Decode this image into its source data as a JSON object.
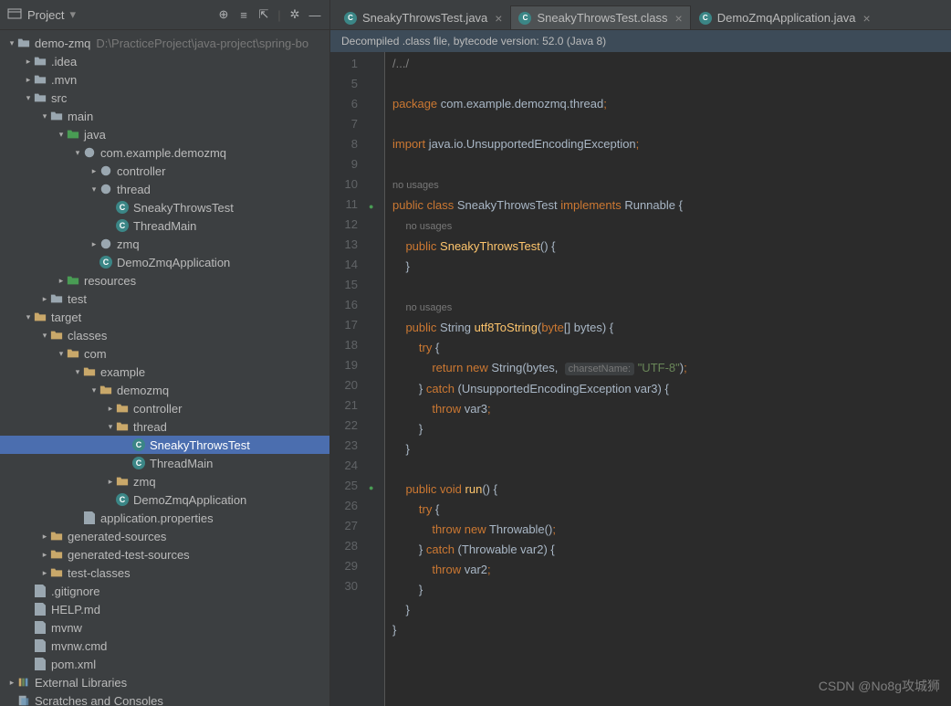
{
  "header": {
    "project": "Project",
    "iconbar": [
      "target",
      "collapse",
      "settings",
      "gear",
      "more"
    ]
  },
  "rootPath": "D:\\PracticeProject\\java-project\\spring-bo",
  "tree": [
    {
      "d": 0,
      "a": "v",
      "ico": "module",
      "lbl": "demo-zmq",
      "path": "D:\\PracticeProject\\java-project\\spring-bo"
    },
    {
      "d": 1,
      "a": ">",
      "ico": "fg",
      "lbl": ".idea"
    },
    {
      "d": 1,
      "a": ">",
      "ico": "fg",
      "lbl": ".mvn"
    },
    {
      "d": 1,
      "a": "v",
      "ico": "fg",
      "lbl": "src"
    },
    {
      "d": 2,
      "a": "v",
      "ico": "fg",
      "lbl": "main"
    },
    {
      "d": 3,
      "a": "v",
      "ico": "fb",
      "lbl": "java"
    },
    {
      "d": 4,
      "a": "v",
      "ico": "pkg",
      "lbl": "com.example.demozmq"
    },
    {
      "d": 5,
      "a": ">",
      "ico": "pkg",
      "lbl": "controller"
    },
    {
      "d": 5,
      "a": "v",
      "ico": "pkg",
      "lbl": "thread"
    },
    {
      "d": 6,
      "a": "",
      "ico": "cls",
      "lbl": "SneakyThrowsTest"
    },
    {
      "d": 6,
      "a": "",
      "ico": "cls",
      "lbl": "ThreadMain"
    },
    {
      "d": 5,
      "a": ">",
      "ico": "pkg",
      "lbl": "zmq"
    },
    {
      "d": 5,
      "a": "",
      "ico": "cls",
      "lbl": "DemoZmqApplication"
    },
    {
      "d": 3,
      "a": ">",
      "ico": "fb",
      "lbl": "resources"
    },
    {
      "d": 2,
      "a": ">",
      "ico": "fg",
      "lbl": "test"
    },
    {
      "d": 1,
      "a": "v",
      "ico": "fo",
      "lbl": "target"
    },
    {
      "d": 2,
      "a": "v",
      "ico": "fo",
      "lbl": "classes"
    },
    {
      "d": 3,
      "a": "v",
      "ico": "fo",
      "lbl": "com"
    },
    {
      "d": 4,
      "a": "v",
      "ico": "fo",
      "lbl": "example"
    },
    {
      "d": 5,
      "a": "v",
      "ico": "fo",
      "lbl": "demozmq"
    },
    {
      "d": 6,
      "a": ">",
      "ico": "fo",
      "lbl": "controller"
    },
    {
      "d": 6,
      "a": "v",
      "ico": "fo",
      "lbl": "thread"
    },
    {
      "d": 7,
      "a": "",
      "ico": "cls",
      "lbl": "SneakyThrowsTest",
      "sel": true
    },
    {
      "d": 7,
      "a": "",
      "ico": "cls",
      "lbl": "ThreadMain"
    },
    {
      "d": 6,
      "a": ">",
      "ico": "fo",
      "lbl": "zmq"
    },
    {
      "d": 6,
      "a": "",
      "ico": "cls",
      "lbl": "DemoZmqApplication"
    },
    {
      "d": 4,
      "a": "",
      "ico": "file",
      "lbl": "application.properties"
    },
    {
      "d": 2,
      "a": ">",
      "ico": "fo",
      "lbl": "generated-sources"
    },
    {
      "d": 2,
      "a": ">",
      "ico": "fo",
      "lbl": "generated-test-sources"
    },
    {
      "d": 2,
      "a": ">",
      "ico": "fo",
      "lbl": "test-classes"
    },
    {
      "d": 1,
      "a": "",
      "ico": "file",
      "lbl": ".gitignore"
    },
    {
      "d": 1,
      "a": "",
      "ico": "file",
      "lbl": "HELP.md"
    },
    {
      "d": 1,
      "a": "",
      "ico": "file",
      "lbl": "mvnw"
    },
    {
      "d": 1,
      "a": "",
      "ico": "file",
      "lbl": "mvnw.cmd"
    },
    {
      "d": 1,
      "a": "",
      "ico": "file",
      "lbl": "pom.xml"
    },
    {
      "d": 0,
      "a": ">",
      "ico": "lib",
      "lbl": "External Libraries"
    },
    {
      "d": 0,
      "a": "",
      "ico": "scratch",
      "lbl": "Scratches and Consoles"
    }
  ],
  "tabs": [
    {
      "lbl": "SneakyThrowsTest.java",
      "active": false
    },
    {
      "lbl": "SneakyThrowsTest.class",
      "active": true
    },
    {
      "lbl": "DemoZmqApplication.java",
      "active": false
    }
  ],
  "banner": "Decompiled .class file, bytecode version: 52.0 (Java 8)",
  "lines": [
    1,
    5,
    6,
    7,
    8,
    9,
    "",
    10,
    "",
    11,
    12,
    13,
    "",
    14,
    15,
    16,
    17,
    18,
    19,
    20,
    21,
    22,
    23,
    24,
    25,
    26,
    27,
    28,
    29,
    30
  ],
  "markers": {
    "7": "●↑",
    "21": "●↑"
  },
  "code": {
    "pkg": "package",
    "pkgname": "com.example.demozmq.thread",
    "imp": "import",
    "impname": "java.io.UnsupportedEncodingException",
    "nousages": "no usages",
    "pub": "public",
    "cls": "class",
    "clsname": "SneakyThrowsTest",
    "impl": "implements",
    "runnable": "Runnable",
    "string": "String",
    "fn_utf": "utf8ToString",
    "byte": "byte",
    "bytes": "bytes",
    "try": "try",
    "ret": "return",
    "new": "new",
    "catch": "catch",
    "throw": "throw",
    "charsetHint": "charsetName:",
    "utf8": "\"UTF-8\"",
    "exc": "UnsupportedEncodingException",
    "var3": "var3",
    "void": "void",
    "run": "run",
    "throwable": "Throwable",
    "var2": "var2",
    "fold": "/.../"
  },
  "watermark": "CSDN @No8g攻城狮"
}
